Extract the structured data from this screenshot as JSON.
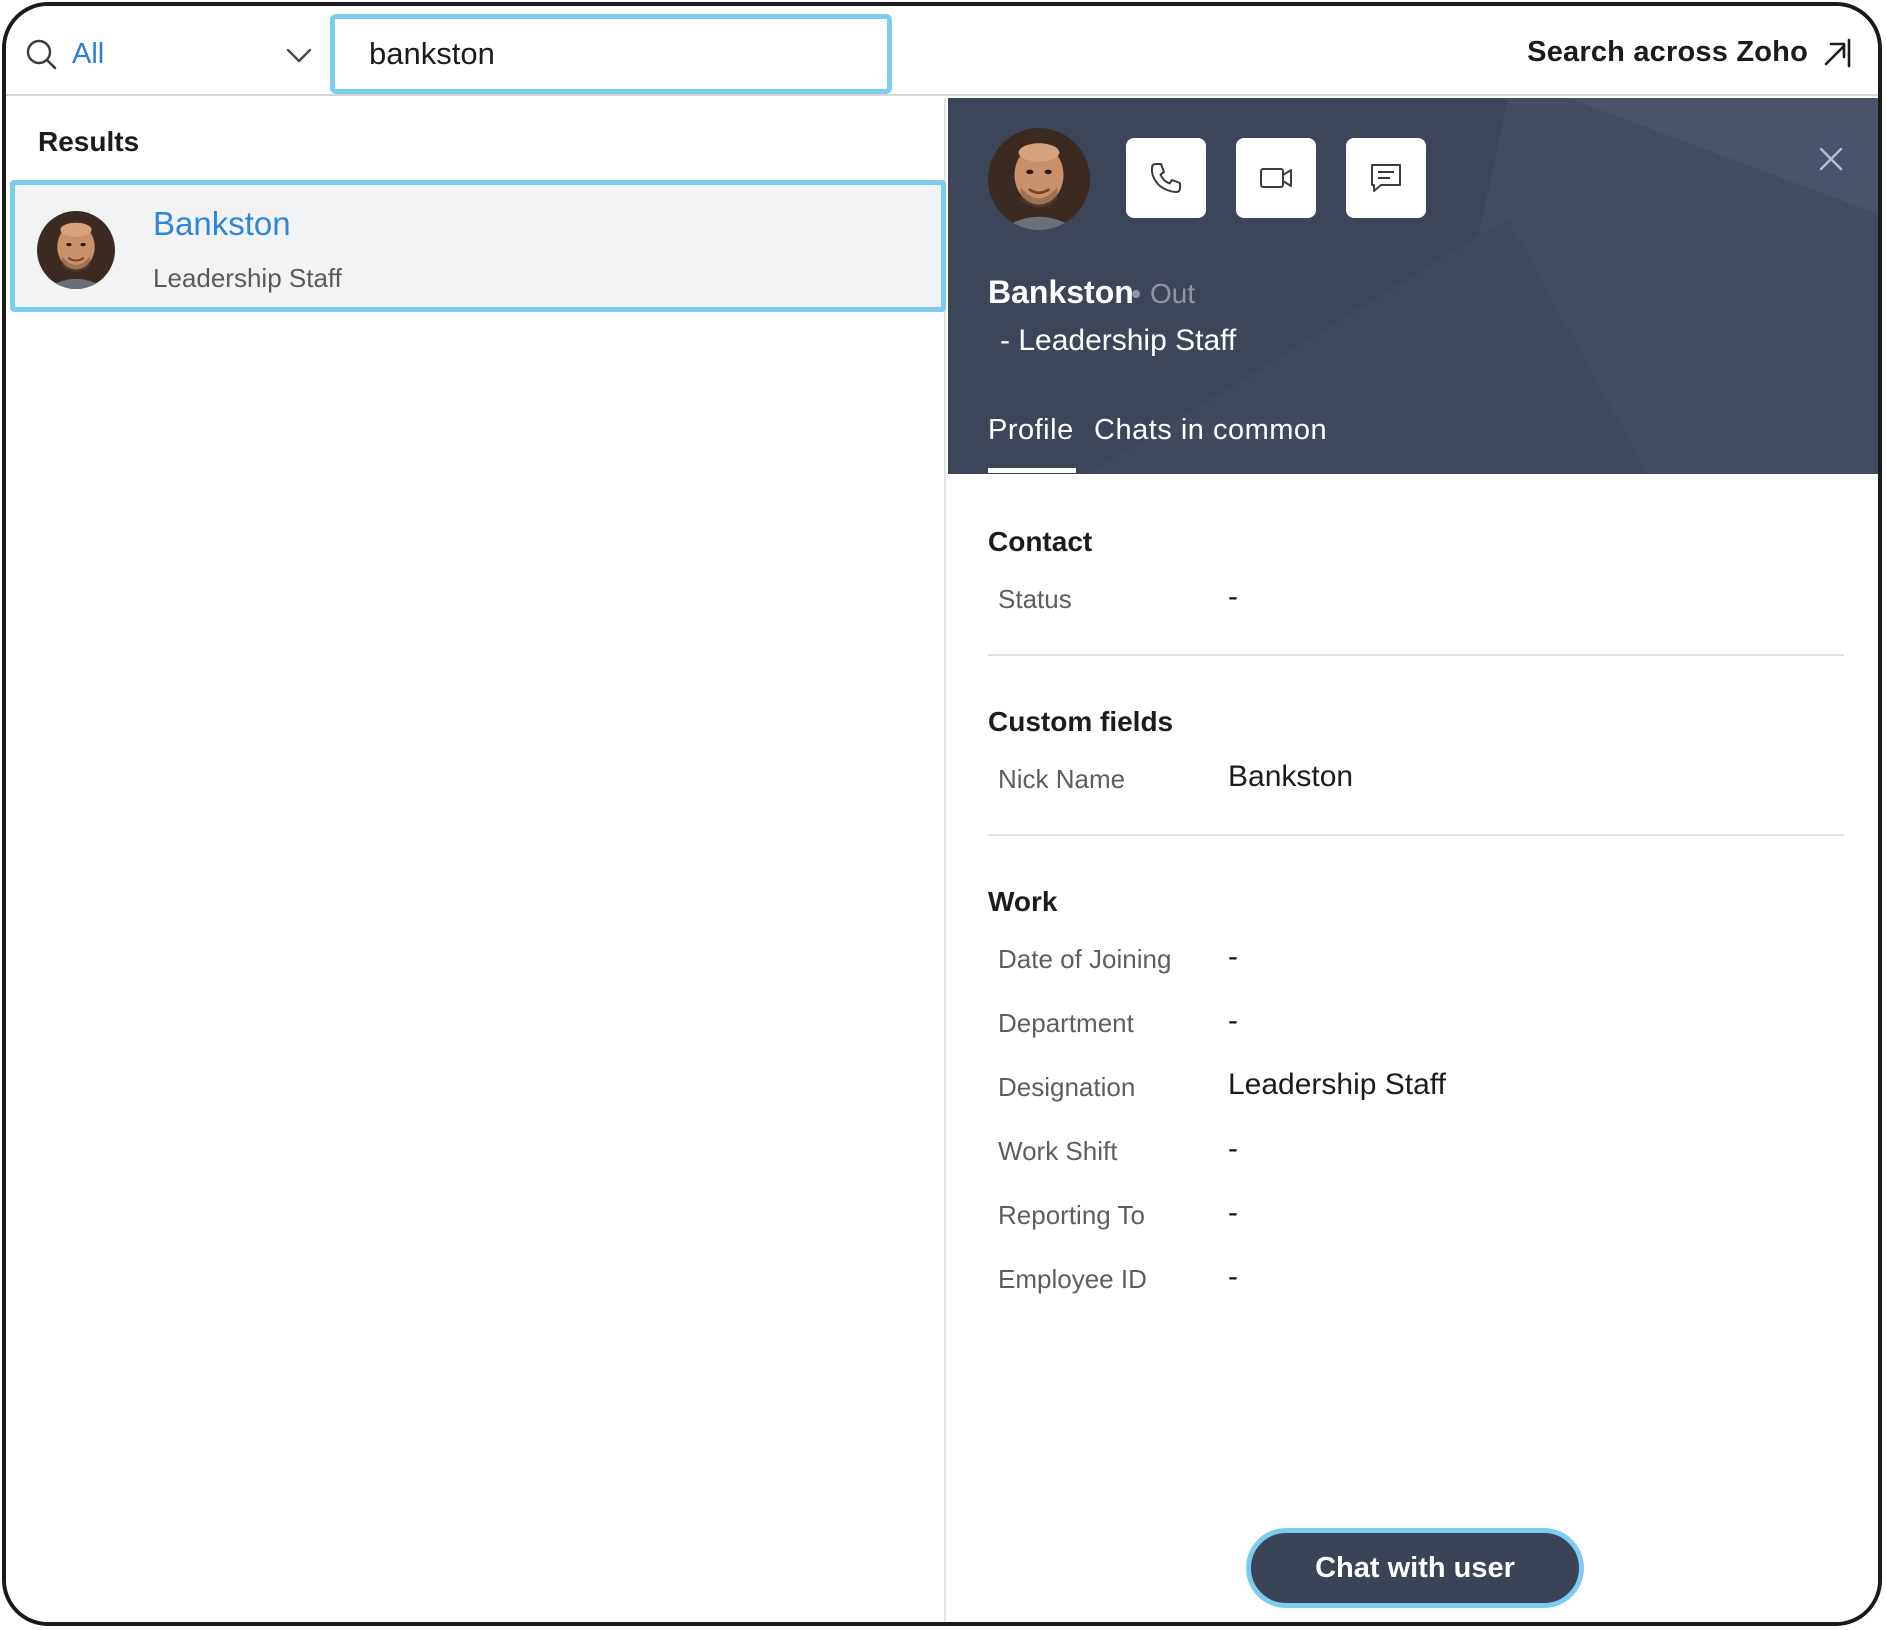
{
  "search": {
    "scope_label": "All",
    "query": "bankston",
    "across_label": "Search across Zoho"
  },
  "results": {
    "title": "Results",
    "items": [
      {
        "name": "Bankston",
        "subtitle": "Leadership Staff"
      }
    ]
  },
  "profile": {
    "name": "Bankston",
    "status": "Out",
    "role": "-  Leadership Staff",
    "tabs": [
      "Profile",
      "Chats in common"
    ],
    "active_tab": "Profile",
    "sections": {
      "contact": {
        "title": "Contact",
        "fields": [
          {
            "label": "Status",
            "value": "-"
          }
        ]
      },
      "custom": {
        "title": "Custom fields",
        "fields": [
          {
            "label": "Nick Name",
            "value": "Bankston"
          }
        ]
      },
      "work": {
        "title": "Work",
        "fields": [
          {
            "label": "Date of Joining",
            "value": "-"
          },
          {
            "label": "Department",
            "value": "-"
          },
          {
            "label": "Designation",
            "value": "Leadership Staff"
          },
          {
            "label": "Work Shift",
            "value": "-"
          },
          {
            "label": "Reporting To",
            "value": "-"
          },
          {
            "label": "Employee ID",
            "value": "-"
          }
        ]
      }
    },
    "chat_button": "Chat with user"
  },
  "icons": {
    "search": "search-icon",
    "dropdown": "chevron-down-icon",
    "external": "external-link-icon",
    "call": "phone-icon",
    "video": "video-camera-icon",
    "message": "message-icon",
    "close": "close-icon"
  },
  "colors": {
    "accent": "#2d86d8",
    "focus_ring": "#7cccf2",
    "profile_header": "#3d4659",
    "chat_button": "#3b4456"
  }
}
